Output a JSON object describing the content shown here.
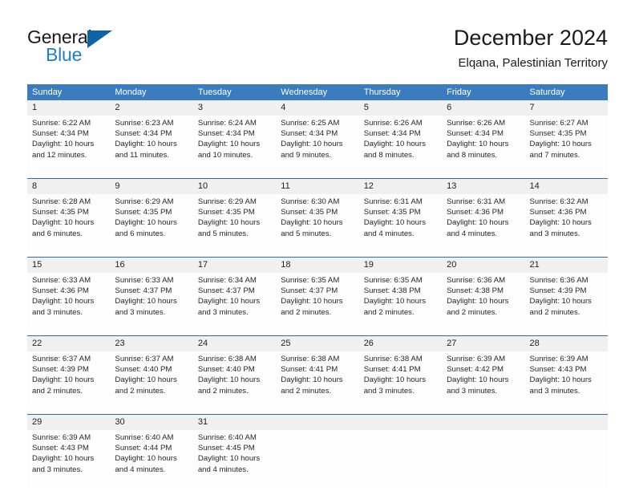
{
  "brand": {
    "name_part1": "General",
    "name_part2": "Blue",
    "triangle_color": "#1062a8",
    "blue_color": "#1f7fc4"
  },
  "header": {
    "title": "December 2024",
    "subtitle": "Elqana, Palestinian Territory"
  },
  "colors": {
    "header_bar": "#3a7cbe",
    "day_number_band": "#f0f0f0",
    "week_separator": "#2e6da4"
  },
  "weekdays": [
    "Sunday",
    "Monday",
    "Tuesday",
    "Wednesday",
    "Thursday",
    "Friday",
    "Saturday"
  ],
  "weeks": [
    [
      {
        "day": "1",
        "sunrise": "Sunrise: 6:22 AM",
        "sunset": "Sunset: 4:34 PM",
        "daylight1": "Daylight: 10 hours",
        "daylight2": "and 12 minutes."
      },
      {
        "day": "2",
        "sunrise": "Sunrise: 6:23 AM",
        "sunset": "Sunset: 4:34 PM",
        "daylight1": "Daylight: 10 hours",
        "daylight2": "and 11 minutes."
      },
      {
        "day": "3",
        "sunrise": "Sunrise: 6:24 AM",
        "sunset": "Sunset: 4:34 PM",
        "daylight1": "Daylight: 10 hours",
        "daylight2": "and 10 minutes."
      },
      {
        "day": "4",
        "sunrise": "Sunrise: 6:25 AM",
        "sunset": "Sunset: 4:34 PM",
        "daylight1": "Daylight: 10 hours",
        "daylight2": "and 9 minutes."
      },
      {
        "day": "5",
        "sunrise": "Sunrise: 6:26 AM",
        "sunset": "Sunset: 4:34 PM",
        "daylight1": "Daylight: 10 hours",
        "daylight2": "and 8 minutes."
      },
      {
        "day": "6",
        "sunrise": "Sunrise: 6:26 AM",
        "sunset": "Sunset: 4:34 PM",
        "daylight1": "Daylight: 10 hours",
        "daylight2": "and 8 minutes."
      },
      {
        "day": "7",
        "sunrise": "Sunrise: 6:27 AM",
        "sunset": "Sunset: 4:35 PM",
        "daylight1": "Daylight: 10 hours",
        "daylight2": "and 7 minutes."
      }
    ],
    [
      {
        "day": "8",
        "sunrise": "Sunrise: 6:28 AM",
        "sunset": "Sunset: 4:35 PM",
        "daylight1": "Daylight: 10 hours",
        "daylight2": "and 6 minutes."
      },
      {
        "day": "9",
        "sunrise": "Sunrise: 6:29 AM",
        "sunset": "Sunset: 4:35 PM",
        "daylight1": "Daylight: 10 hours",
        "daylight2": "and 6 minutes."
      },
      {
        "day": "10",
        "sunrise": "Sunrise: 6:29 AM",
        "sunset": "Sunset: 4:35 PM",
        "daylight1": "Daylight: 10 hours",
        "daylight2": "and 5 minutes."
      },
      {
        "day": "11",
        "sunrise": "Sunrise: 6:30 AM",
        "sunset": "Sunset: 4:35 PM",
        "daylight1": "Daylight: 10 hours",
        "daylight2": "and 5 minutes."
      },
      {
        "day": "12",
        "sunrise": "Sunrise: 6:31 AM",
        "sunset": "Sunset: 4:35 PM",
        "daylight1": "Daylight: 10 hours",
        "daylight2": "and 4 minutes."
      },
      {
        "day": "13",
        "sunrise": "Sunrise: 6:31 AM",
        "sunset": "Sunset: 4:36 PM",
        "daylight1": "Daylight: 10 hours",
        "daylight2": "and 4 minutes."
      },
      {
        "day": "14",
        "sunrise": "Sunrise: 6:32 AM",
        "sunset": "Sunset: 4:36 PM",
        "daylight1": "Daylight: 10 hours",
        "daylight2": "and 3 minutes."
      }
    ],
    [
      {
        "day": "15",
        "sunrise": "Sunrise: 6:33 AM",
        "sunset": "Sunset: 4:36 PM",
        "daylight1": "Daylight: 10 hours",
        "daylight2": "and 3 minutes."
      },
      {
        "day": "16",
        "sunrise": "Sunrise: 6:33 AM",
        "sunset": "Sunset: 4:37 PM",
        "daylight1": "Daylight: 10 hours",
        "daylight2": "and 3 minutes."
      },
      {
        "day": "17",
        "sunrise": "Sunrise: 6:34 AM",
        "sunset": "Sunset: 4:37 PM",
        "daylight1": "Daylight: 10 hours",
        "daylight2": "and 3 minutes."
      },
      {
        "day": "18",
        "sunrise": "Sunrise: 6:35 AM",
        "sunset": "Sunset: 4:37 PM",
        "daylight1": "Daylight: 10 hours",
        "daylight2": "and 2 minutes."
      },
      {
        "day": "19",
        "sunrise": "Sunrise: 6:35 AM",
        "sunset": "Sunset: 4:38 PM",
        "daylight1": "Daylight: 10 hours",
        "daylight2": "and 2 minutes."
      },
      {
        "day": "20",
        "sunrise": "Sunrise: 6:36 AM",
        "sunset": "Sunset: 4:38 PM",
        "daylight1": "Daylight: 10 hours",
        "daylight2": "and 2 minutes."
      },
      {
        "day": "21",
        "sunrise": "Sunrise: 6:36 AM",
        "sunset": "Sunset: 4:39 PM",
        "daylight1": "Daylight: 10 hours",
        "daylight2": "and 2 minutes."
      }
    ],
    [
      {
        "day": "22",
        "sunrise": "Sunrise: 6:37 AM",
        "sunset": "Sunset: 4:39 PM",
        "daylight1": "Daylight: 10 hours",
        "daylight2": "and 2 minutes."
      },
      {
        "day": "23",
        "sunrise": "Sunrise: 6:37 AM",
        "sunset": "Sunset: 4:40 PM",
        "daylight1": "Daylight: 10 hours",
        "daylight2": "and 2 minutes."
      },
      {
        "day": "24",
        "sunrise": "Sunrise: 6:38 AM",
        "sunset": "Sunset: 4:40 PM",
        "daylight1": "Daylight: 10 hours",
        "daylight2": "and 2 minutes."
      },
      {
        "day": "25",
        "sunrise": "Sunrise: 6:38 AM",
        "sunset": "Sunset: 4:41 PM",
        "daylight1": "Daylight: 10 hours",
        "daylight2": "and 2 minutes."
      },
      {
        "day": "26",
        "sunrise": "Sunrise: 6:38 AM",
        "sunset": "Sunset: 4:41 PM",
        "daylight1": "Daylight: 10 hours",
        "daylight2": "and 3 minutes."
      },
      {
        "day": "27",
        "sunrise": "Sunrise: 6:39 AM",
        "sunset": "Sunset: 4:42 PM",
        "daylight1": "Daylight: 10 hours",
        "daylight2": "and 3 minutes."
      },
      {
        "day": "28",
        "sunrise": "Sunrise: 6:39 AM",
        "sunset": "Sunset: 4:43 PM",
        "daylight1": "Daylight: 10 hours",
        "daylight2": "and 3 minutes."
      }
    ],
    [
      {
        "day": "29",
        "sunrise": "Sunrise: 6:39 AM",
        "sunset": "Sunset: 4:43 PM",
        "daylight1": "Daylight: 10 hours",
        "daylight2": "and 3 minutes."
      },
      {
        "day": "30",
        "sunrise": "Sunrise: 6:40 AM",
        "sunset": "Sunset: 4:44 PM",
        "daylight1": "Daylight: 10 hours",
        "daylight2": "and 4 minutes."
      },
      {
        "day": "31",
        "sunrise": "Sunrise: 6:40 AM",
        "sunset": "Sunset: 4:45 PM",
        "daylight1": "Daylight: 10 hours",
        "daylight2": "and 4 minutes."
      },
      {
        "day": "",
        "sunrise": "",
        "sunset": "",
        "daylight1": "",
        "daylight2": ""
      },
      {
        "day": "",
        "sunrise": "",
        "sunset": "",
        "daylight1": "",
        "daylight2": ""
      },
      {
        "day": "",
        "sunrise": "",
        "sunset": "",
        "daylight1": "",
        "daylight2": ""
      },
      {
        "day": "",
        "sunrise": "",
        "sunset": "",
        "daylight1": "",
        "daylight2": ""
      }
    ]
  ]
}
